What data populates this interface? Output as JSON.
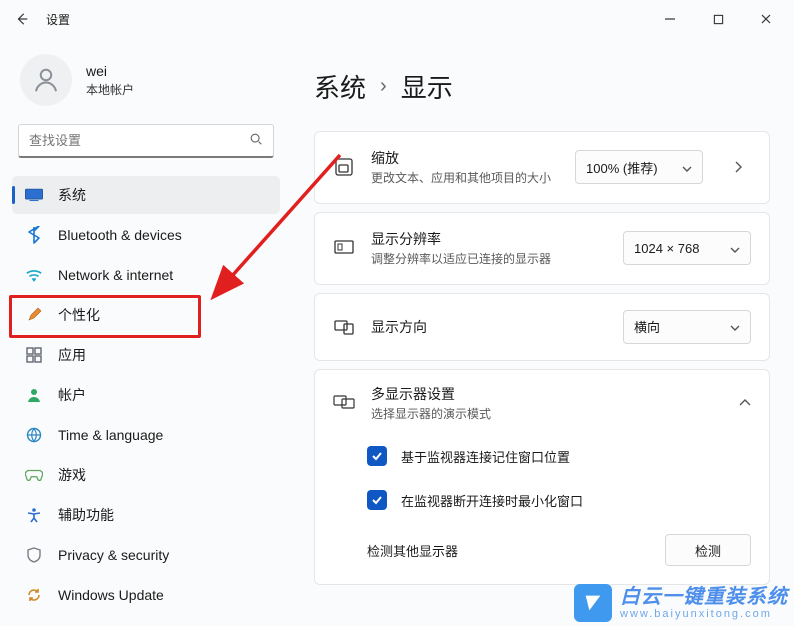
{
  "window": {
    "title": "设置"
  },
  "user": {
    "name": "wei",
    "subtitle": "本地帐户"
  },
  "search": {
    "placeholder": "查找设置"
  },
  "nav": [
    {
      "id": "system",
      "label": "系统",
      "icon": "system-icon"
    },
    {
      "id": "bluetooth",
      "label": "Bluetooth & devices",
      "icon": "bluetooth-icon"
    },
    {
      "id": "network",
      "label": "Network & internet",
      "icon": "wifi-icon"
    },
    {
      "id": "personalization",
      "label": "个性化",
      "icon": "brush-icon"
    },
    {
      "id": "apps",
      "label": "应用",
      "icon": "apps-icon"
    },
    {
      "id": "accounts",
      "label": "帐户",
      "icon": "person-icon"
    },
    {
      "id": "time",
      "label": "Time & language",
      "icon": "globe-icon"
    },
    {
      "id": "gaming",
      "label": "游戏",
      "icon": "game-icon"
    },
    {
      "id": "accessibility",
      "label": "辅助功能",
      "icon": "accessibility-icon"
    },
    {
      "id": "privacy",
      "label": "Privacy & security",
      "icon": "shield-icon"
    },
    {
      "id": "update",
      "label": "Windows Update",
      "icon": "update-icon"
    }
  ],
  "breadcrumb": {
    "root": "系统",
    "current": "显示"
  },
  "cards": {
    "scale": {
      "title": "缩放",
      "desc": "更改文本、应用和其他项目的大小",
      "value": "100% (推荐)"
    },
    "resolution": {
      "title": "显示分辨率",
      "desc": "调整分辨率以适应已连接的显示器",
      "value": "1024 × 768"
    },
    "orientation": {
      "title": "显示方向",
      "value": "横向"
    },
    "multi": {
      "title": "多显示器设置",
      "desc": "选择显示器的演示模式",
      "opt1": "基于监视器连接记住窗口位置",
      "opt2": "在监视器断开连接时最小化窗口",
      "detect_label": "检测其他显示器",
      "detect_button": "检测"
    }
  },
  "watermark": {
    "main": "白云一键重装系统",
    "sub": "www.baiyunxitong.com"
  }
}
